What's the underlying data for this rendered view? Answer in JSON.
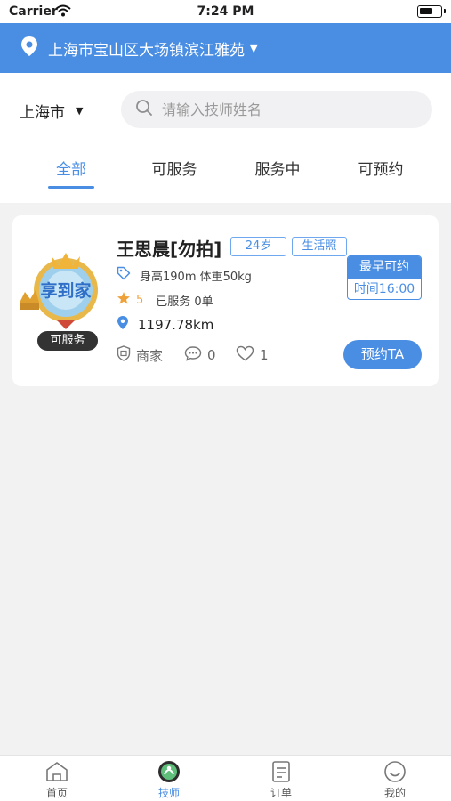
{
  "status_bar": {
    "carrier": "Carrier",
    "time": "7:24 PM"
  },
  "location": {
    "address": "上海市宝山区大场镇滨江雅苑"
  },
  "city_select": {
    "value": "上海市"
  },
  "search": {
    "placeholder": "请输入技师姓名"
  },
  "tabs": [
    {
      "label": "全部",
      "active": true
    },
    {
      "label": "可服务",
      "active": false
    },
    {
      "label": "服务中",
      "active": false
    },
    {
      "label": "可预约",
      "active": false
    }
  ],
  "technician": {
    "name": "王思晨[勿拍]",
    "age": "24岁",
    "photo_tag": "生活照",
    "avatar_brand": "享到家",
    "status": "可服务",
    "body": "身高190m 体重50kg",
    "rating": "5",
    "served": "已服务 0单",
    "distance": "1197.78km",
    "shop": "商家",
    "comments": "0",
    "likes": "1",
    "earliest_label": "最早可约",
    "earliest_time": "时间16:00",
    "book_label": "预约TA"
  },
  "tabbar": [
    {
      "label": "首页",
      "icon": "home-icon",
      "active": false
    },
    {
      "label": "技师",
      "icon": "technician-icon",
      "active": true
    },
    {
      "label": "订单",
      "icon": "order-icon",
      "active": false
    },
    {
      "label": "我的",
      "icon": "profile-icon",
      "active": false
    }
  ],
  "colors": {
    "accent": "#4a8ee4",
    "rating": "#f0a23a",
    "background": "#f2f2f2"
  }
}
